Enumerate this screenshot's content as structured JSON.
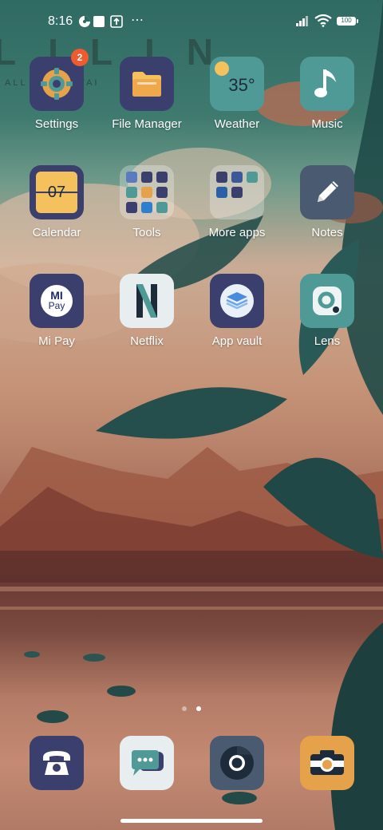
{
  "status_bar": {
    "time": "8:16",
    "dots": "⋯",
    "battery": "100"
  },
  "wallpaper": {
    "title": "LILIN",
    "subtitle": "ALL ••••• ATTAI"
  },
  "apps": [
    {
      "label": "Settings",
      "icon": "gear-icon",
      "badge": "2"
    },
    {
      "label": "File Manager",
      "icon": "folder-icon"
    },
    {
      "label": "Weather",
      "icon": "sun-icon",
      "temp": "35°"
    },
    {
      "label": "Music",
      "icon": "music-note-icon"
    },
    {
      "label": "Calendar",
      "icon": "calendar-icon",
      "date": "07"
    },
    {
      "label": "Tools",
      "icon": "folder-grid-icon"
    },
    {
      "label": "More apps",
      "icon": "folder-grid-icon"
    },
    {
      "label": "Notes",
      "icon": "pencil-icon"
    },
    {
      "label": "Mi Pay",
      "icon": "mi-pay-icon",
      "mark_top": "MI",
      "mark_bottom": "Pay"
    },
    {
      "label": "Netflix",
      "icon": "netflix-icon",
      "mark": "N"
    },
    {
      "label": "App vault",
      "icon": "layers-icon"
    },
    {
      "label": "Lens",
      "icon": "lens-icon"
    }
  ],
  "dock": [
    {
      "icon": "phone-icon"
    },
    {
      "icon": "messages-icon"
    },
    {
      "icon": "chrome-icon"
    },
    {
      "icon": "camera-icon"
    }
  ],
  "page_indicator": {
    "pages": 2,
    "current": 2
  },
  "colors": {
    "icon_navy": "#3a3f6e",
    "icon_teal": "#4f9a96",
    "badge": "#ef5a2f",
    "accent_yellow": "#f5c15c",
    "accent_orange": "#e6a24a"
  }
}
